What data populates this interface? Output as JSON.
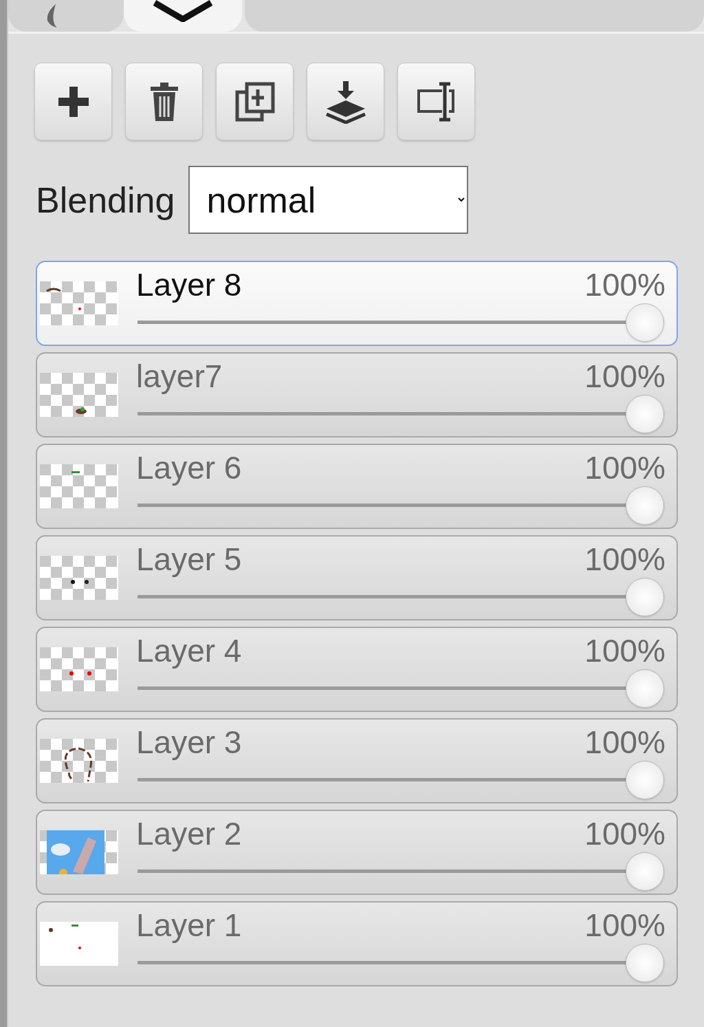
{
  "tabs": [
    {
      "kind": "brush",
      "selected": false
    },
    {
      "kind": "layers",
      "selected": true
    },
    {
      "kind": "blank",
      "selected": false
    }
  ],
  "toolbar": [
    {
      "kind": "add"
    },
    {
      "kind": "delete"
    },
    {
      "kind": "duplicate"
    },
    {
      "kind": "merge"
    },
    {
      "kind": "rename"
    }
  ],
  "blending": {
    "label": "Blending",
    "value": "normal"
  },
  "layers": [
    {
      "name": "Layer 8",
      "opacity": "100%",
      "level": 1,
      "selected": true
    },
    {
      "name": "layer7",
      "opacity": "100%",
      "level": 1,
      "selected": false
    },
    {
      "name": "Layer 6",
      "opacity": "100%",
      "level": 1,
      "selected": false
    },
    {
      "name": "Layer 5",
      "opacity": "100%",
      "level": 1,
      "selected": false
    },
    {
      "name": "Layer 4",
      "opacity": "100%",
      "level": 1,
      "selected": false
    },
    {
      "name": "Layer 3",
      "opacity": "100%",
      "level": 1,
      "selected": false
    },
    {
      "name": "Layer 2",
      "opacity": "100%",
      "level": 1,
      "selected": false
    },
    {
      "name": "Layer 1",
      "opacity": "100%",
      "level": 1,
      "selected": false
    }
  ]
}
